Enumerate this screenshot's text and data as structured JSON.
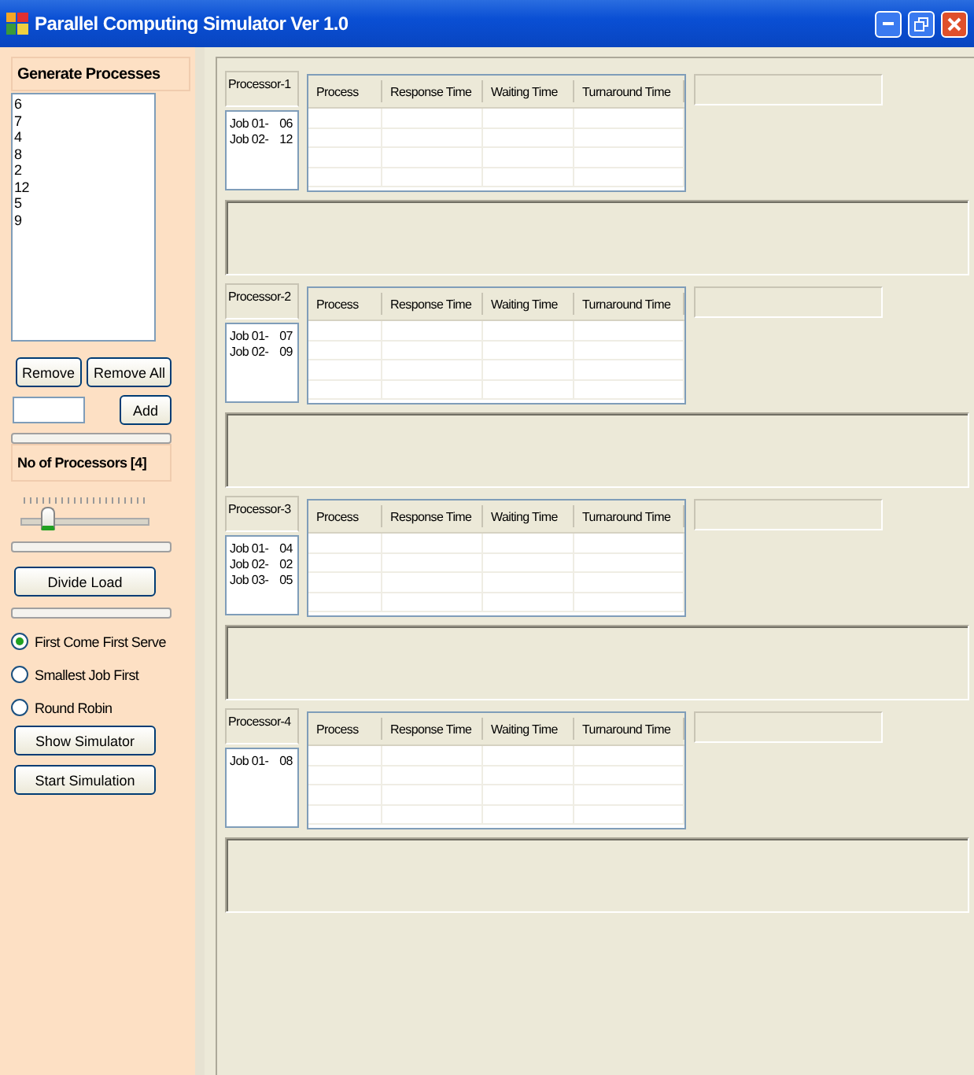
{
  "window": {
    "title": "Parallel Computing Simulator Ver 1.0"
  },
  "sidebar": {
    "header": "Generate Processes",
    "process_list": [
      "6",
      "7",
      "4",
      "8",
      "2",
      "12",
      "5",
      "9"
    ],
    "remove_buttons": [
      "Remove",
      "Remove All"
    ],
    "add_button": "Add",
    "processors_label": "No of Processors [4]",
    "slider": {
      "level": 0.2
    },
    "divide_button": "Divide Load",
    "algorithms": [
      {
        "label": "First Come First Serve",
        "selected": true
      },
      {
        "label": "Smallest Job First",
        "selected": false
      },
      {
        "label": "Round Robin",
        "selected": false
      }
    ],
    "actions": [
      "Show Simulator",
      "Start Simulation"
    ]
  },
  "processors": [
    {
      "name": "Processor-1",
      "jobs": [
        {
          "label": "Job 01-",
          "value": "06"
        },
        {
          "label": "Job 02-",
          "value": "12"
        }
      ],
      "columns": [
        "Process",
        "Response Time",
        "Waiting Time",
        "Turnaround Time"
      ]
    },
    {
      "name": "Processor-2",
      "jobs": [
        {
          "label": "Job 01-",
          "value": "07"
        },
        {
          "label": "Job 02-",
          "value": "09"
        }
      ],
      "columns": [
        "Process",
        "Response Time",
        "Waiting Time",
        "Turnaround Time"
      ]
    },
    {
      "name": "Processor-3",
      "jobs": [
        {
          "label": "Job 01-",
          "value": "04"
        },
        {
          "label": "Job 02-",
          "value": "02"
        },
        {
          "label": "Job 03-",
          "value": "05"
        }
      ],
      "columns": [
        "Process",
        "Response Time",
        "Waiting Time",
        "Turnaround Time"
      ]
    },
    {
      "name": "Processor-4",
      "jobs": [
        {
          "label": "Job 01-",
          "value": "08"
        }
      ],
      "columns": [
        "Process",
        "Response Time",
        "Waiting Time",
        "Turnaround Time"
      ]
    }
  ]
}
